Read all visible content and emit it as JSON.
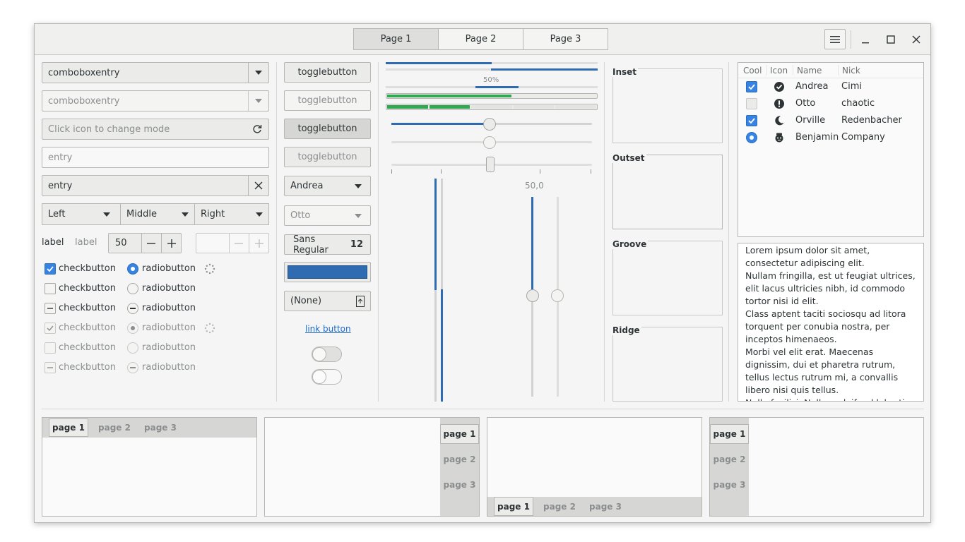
{
  "header": {
    "tabs": [
      {
        "label": "Page 1",
        "active": true
      },
      {
        "label": "Page 2"
      },
      {
        "label": "Page 3"
      }
    ],
    "icons": [
      "hamburger-menu-icon",
      "minimize-icon",
      "maximize-icon",
      "close-icon"
    ]
  },
  "col1": {
    "combo1": "comboboxentry",
    "combo2": "comboboxentry",
    "icon_entry_placeholder": "Click icon to change mode",
    "entry_placeholder": "entry",
    "entry_value": "entry",
    "segments": [
      "Left",
      "Middle",
      "Right"
    ],
    "label1": "label",
    "label2": "label",
    "spin_value": "50",
    "checks": [
      "checkbutton",
      "checkbutton",
      "checkbutton",
      "checkbutton",
      "checkbutton",
      "checkbutton"
    ],
    "radios": [
      "radiobutton",
      "radiobutton",
      "radiobutton",
      "radiobutton",
      "radiobutton",
      "radiobutton"
    ]
  },
  "col2": {
    "toggles": [
      "togglebutton",
      "togglebutton",
      "togglebutton",
      "togglebutton"
    ],
    "combo_andrea": "Andrea",
    "combo_otto": "Otto",
    "font_name": "Sans Regular",
    "font_size": "12",
    "color_hex": "#2e6bb0",
    "file_none": "(None)",
    "link": "link button"
  },
  "col3": {
    "progress_text": "50%",
    "scale_value": "50,0"
  },
  "frames": [
    "Inset",
    "Outset",
    "Groove",
    "Ridge"
  ],
  "tree": {
    "headers": [
      "Cool",
      "Icon",
      "Name",
      "Nick"
    ],
    "rows": [
      {
        "cool": "checked",
        "icon": "check-circle-icon",
        "name": "Andrea",
        "nick": "Cimi"
      },
      {
        "cool": "unchecked",
        "icon": "alert-circle-icon",
        "name": "Otto",
        "nick": "chaotic"
      },
      {
        "cool": "checked",
        "icon": "moon-icon",
        "name": "Orville",
        "nick": "Redenbacher"
      },
      {
        "cool": "radio",
        "icon": "face-icon",
        "name": "Benjamin",
        "nick": "Company"
      }
    ]
  },
  "textview": "Lorem ipsum dolor sit amet, consectetur adipiscing elit.\nNullam fringilla, est ut feugiat ultrices, elit lacus ultricies nibh, id commodo tortor nisi id elit.\nClass aptent taciti sociosqu ad litora torquent per conubia nostra, per inceptos himenaeos.\nMorbi vel elit erat. Maecenas dignissim, dui et pharetra rutrum, tellus lectus rutrum mi, a convallis libero nisi quis tellus.\nNulla facilisi. Nullam eleifend lobortis nisl, in porttitor tellus malesuada vitae.",
  "notebooks": [
    {
      "tabs": [
        "page 1",
        "page 2",
        "page 3"
      ]
    },
    {
      "tabs": [
        "page 1",
        "page 2",
        "page 3"
      ]
    },
    {
      "tabs": [
        "page 1",
        "page 2",
        "page 3"
      ]
    },
    {
      "tabs": [
        "page 1",
        "page 2",
        "page 3"
      ]
    }
  ]
}
